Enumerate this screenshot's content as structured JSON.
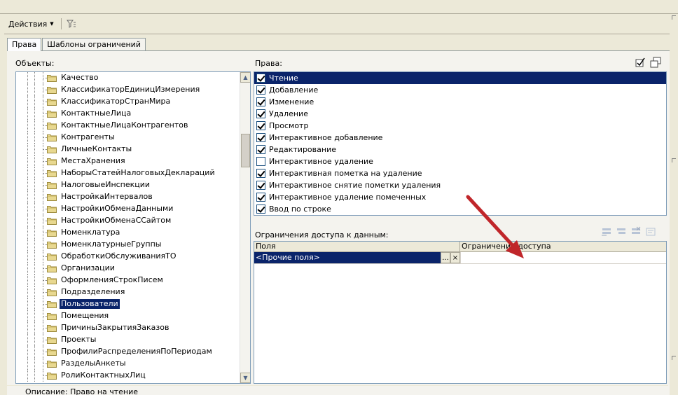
{
  "toolbar": {
    "actions_label": "Действия",
    "filter_icon": "filter-funnel-icon"
  },
  "tabs": [
    {
      "label": "Права",
      "active": true
    },
    {
      "label": "Шаблоны ограничений",
      "active": false
    }
  ],
  "objects": {
    "label": "Объекты:",
    "items": [
      {
        "label": "Качество",
        "selected": false
      },
      {
        "label": "КлассификаторЕдиницИзмерения",
        "selected": false
      },
      {
        "label": "КлассификаторСтранМира",
        "selected": false
      },
      {
        "label": "КонтактныеЛица",
        "selected": false
      },
      {
        "label": "КонтактныеЛицаКонтрагентов",
        "selected": false
      },
      {
        "label": "Контрагенты",
        "selected": false
      },
      {
        "label": "ЛичныеКонтакты",
        "selected": false
      },
      {
        "label": "МестаХранения",
        "selected": false
      },
      {
        "label": "НаборыСтатейНалоговыхДеклараций",
        "selected": false
      },
      {
        "label": "НалоговыеИнспекции",
        "selected": false
      },
      {
        "label": "НастройкаИнтервалов",
        "selected": false
      },
      {
        "label": "НастройкиОбменаДанными",
        "selected": false
      },
      {
        "label": "НастройкиОбменаССайтом",
        "selected": false
      },
      {
        "label": "Номенклатура",
        "selected": false
      },
      {
        "label": "НоменклатурныеГруппы",
        "selected": false
      },
      {
        "label": "ОбработкиОбслуживанияТО",
        "selected": false
      },
      {
        "label": "Организации",
        "selected": false
      },
      {
        "label": "ОформленияСтрокПисем",
        "selected": false
      },
      {
        "label": "Подразделения",
        "selected": false
      },
      {
        "label": "Пользователи",
        "selected": true
      },
      {
        "label": "Помещения",
        "selected": false
      },
      {
        "label": "ПричиныЗакрытияЗаказов",
        "selected": false
      },
      {
        "label": "Проекты",
        "selected": false
      },
      {
        "label": "ПрофилиРаспределенияПоПериодам",
        "selected": false
      },
      {
        "label": "РазделыАнкеты",
        "selected": false
      },
      {
        "label": "РолиКонтактныхЛиц",
        "selected": false
      }
    ]
  },
  "rights": {
    "label": "Права:",
    "items": [
      {
        "label": "Чтение",
        "checked": true,
        "selected": true
      },
      {
        "label": "Добавление",
        "checked": true,
        "selected": false
      },
      {
        "label": "Изменение",
        "checked": true,
        "selected": false
      },
      {
        "label": "Удаление",
        "checked": true,
        "selected": false
      },
      {
        "label": "Просмотр",
        "checked": true,
        "selected": false
      },
      {
        "label": "Интерактивное добавление",
        "checked": true,
        "selected": false
      },
      {
        "label": "Редактирование",
        "checked": true,
        "selected": false
      },
      {
        "label": "Интерактивное удаление",
        "checked": false,
        "selected": false
      },
      {
        "label": "Интерактивная пометка на удаление",
        "checked": true,
        "selected": false
      },
      {
        "label": "Интерактивное снятие пометки удаления",
        "checked": true,
        "selected": false
      },
      {
        "label": "Интерактивное удаление помеченных",
        "checked": true,
        "selected": false
      },
      {
        "label": "Ввод по строке",
        "checked": true,
        "selected": false
      }
    ]
  },
  "restrictions": {
    "label": "Ограничения доступа к данным:",
    "columns": [
      "Поля",
      "Ограничение доступа"
    ],
    "rows": [
      {
        "field": "<Прочие поля>",
        "restriction": ""
      }
    ],
    "choose_button": "...",
    "clear_button": "×"
  },
  "description": {
    "label": "Описание:",
    "value": "Право на чтение"
  },
  "colors": {
    "selection": "#0a246a",
    "annotation_arrow": "#c0262a"
  }
}
